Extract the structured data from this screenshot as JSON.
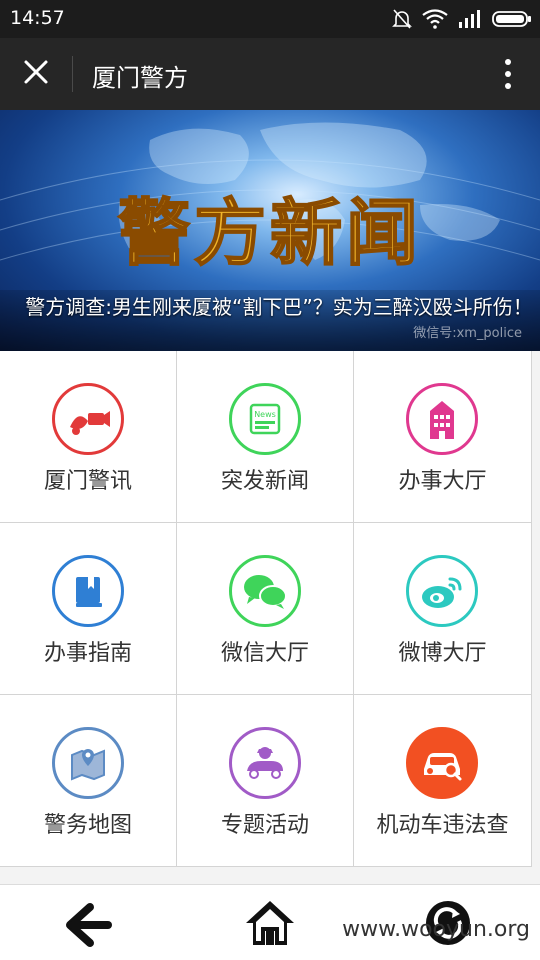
{
  "status_bar": {
    "time": "14:57"
  },
  "header": {
    "title": "厦门警方"
  },
  "banner": {
    "title_text": "警方新闻",
    "caption": "警方调查:男生刚来厦被“割下巴”？实为三醉汉殴斗所伤！",
    "watermark": "微信号:xm_police"
  },
  "grid": {
    "items": [
      {
        "label": "厦门警讯",
        "icon": "police-news-icon",
        "color": "#e23a3a"
      },
      {
        "label": "突发新闻",
        "icon": "news-icon",
        "color": "#3fd45a"
      },
      {
        "label": "办事大厅",
        "icon": "building-icon",
        "color": "#e0388f"
      },
      {
        "label": "办事指南",
        "icon": "guide-book-icon",
        "color": "#2f7fd4"
      },
      {
        "label": "微信大厅",
        "icon": "wechat-icon",
        "color": "#3fd45a"
      },
      {
        "label": "微博大厅",
        "icon": "weibo-icon",
        "color": "#2cc9c0"
      },
      {
        "label": "警务地图",
        "icon": "map-icon",
        "color": "#5c8bc4"
      },
      {
        "label": "专题活动",
        "icon": "special-event-icon",
        "color": "#a15bc7"
      },
      {
        "label": "机动车违法查",
        "icon": "car-violation-icon",
        "color": "#f25022"
      }
    ]
  },
  "bottom_nav": {
    "watermark": "www.wooyun.org"
  }
}
